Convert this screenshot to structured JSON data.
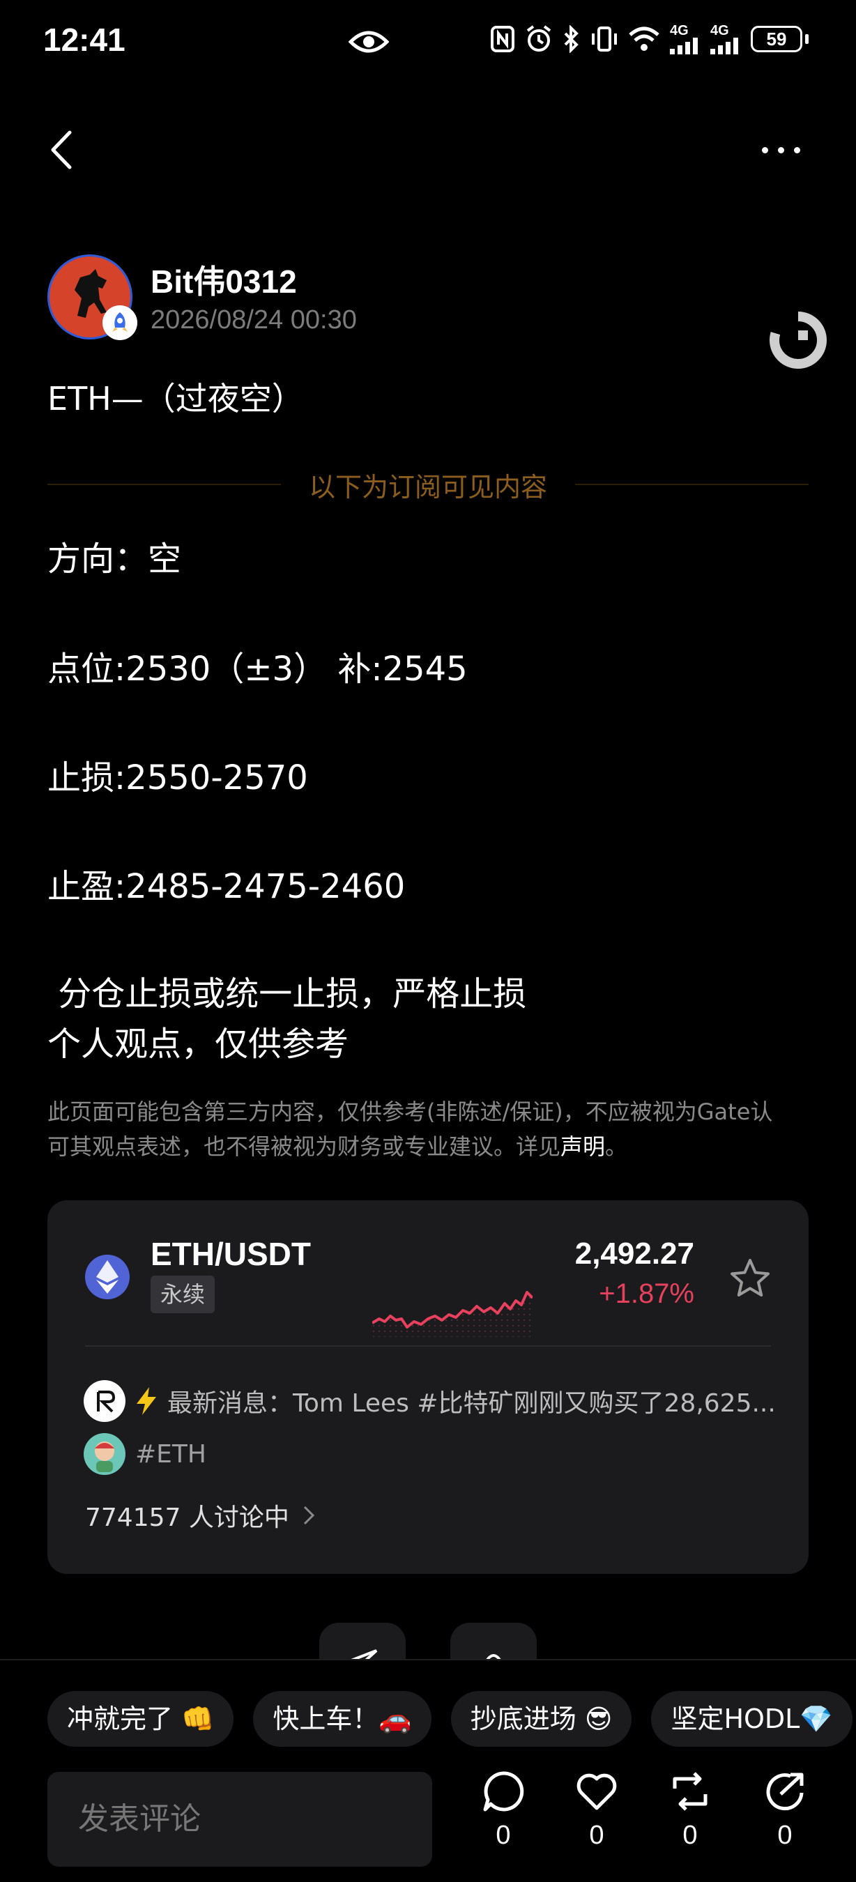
{
  "status_bar": {
    "time": "12:41",
    "battery": "59",
    "net1": "4G",
    "net2": "4G"
  },
  "post": {
    "author": "Bit伟0312",
    "timestamp": "2026/08/24 00:30",
    "title": "ETH—（过夜空）",
    "subscriber_divider": "以下为订阅可见内容",
    "lines": [
      "方向：空",
      "点位:2530（±3） 补:2545",
      "止损:2550-2570",
      "止盈:2485-2475-2460",
      " 分仓止损或统一止损，严格止损",
      "个人观点，仅供参考"
    ],
    "disclaimer_line1": "此页面可能包含第三方内容，仅供参考(非陈述/保证)，不应被视为Gate认",
    "disclaimer_line2": "可其观点表述，也不得被视为财务或专业建议。详见",
    "disclaimer_link": "声明",
    "disclaimer_end": "。"
  },
  "market_card": {
    "pair": "ETH/USDT",
    "tag": "永续",
    "price": "2,492.27",
    "change": "+1.87%",
    "change_color": "#e8415e",
    "news_label": "最新消息：",
    "news_text": "Tom Lees #比特矿刚刚又购买了28,625...",
    "hashtag": "#ETH",
    "discussion": "774157 人讨论中"
  },
  "quick_replies": [
    "冲就完了 👊",
    "快上车！🚗",
    "抄底进场 😎",
    "坚定HODL💎"
  ],
  "comment_placeholder": "发表评论",
  "actions": {
    "comment_count": "0",
    "like_count": "0",
    "repost_count": "0",
    "share_count": "0"
  },
  "icons": [
    "back-arrow-icon",
    "more-icon",
    "eye-icon",
    "gate-logo-icon",
    "eth-icon",
    "star-icon",
    "lightning-icon",
    "comment-icon",
    "heart-icon",
    "repost-icon",
    "share-icon"
  ]
}
